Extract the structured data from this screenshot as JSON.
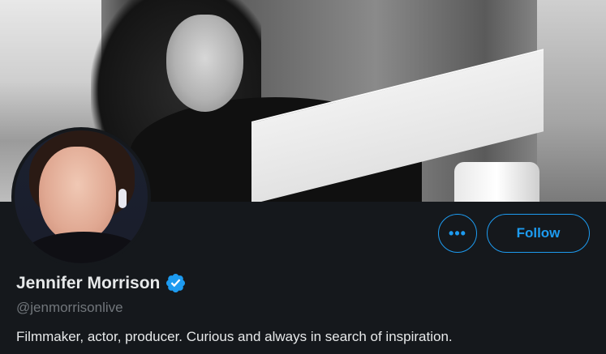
{
  "profile": {
    "name": "Jennifer Morrison",
    "handle": "@jenmorrisonlive",
    "bio": "Filmmaker, actor, producer. Curious and always in search of inspiration.",
    "verified": true
  },
  "actions": {
    "more_label": "•••",
    "follow_label": "Follow"
  },
  "icons": {
    "verified": "verified-badge-icon",
    "more": "more-options-icon"
  },
  "colors": {
    "accent": "#1d9bf0",
    "background": "#15181c",
    "text_primary": "#e7e9ea",
    "text_secondary": "#71767b"
  }
}
